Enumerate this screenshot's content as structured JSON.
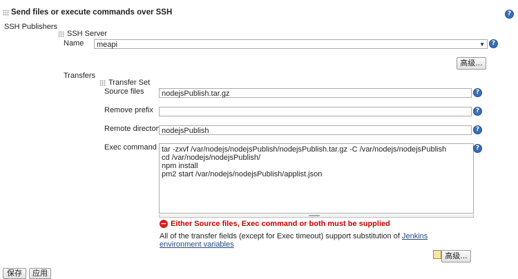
{
  "section": {
    "title": "Send files or execute commands over SSH"
  },
  "ssh_publishers_label": "SSH Publishers",
  "ssh_server": {
    "header": "SSH Server",
    "name_label": "Name",
    "name_value": "meapi",
    "advanced_button": "高级..."
  },
  "transfers": {
    "label": "Transfers",
    "set_header": "Transfer Set",
    "source_files_label": "Source files",
    "source_files_value": "nodejsPublish.tar.gz",
    "remove_prefix_label": "Remove prefix",
    "remove_prefix_value": "",
    "remote_directory_label": "Remote directory",
    "remote_directory_value": "nodejsPublish",
    "exec_command_label": "Exec command",
    "exec_command_value": "tar -zxvf /var/nodejs/nodejsPublish/nodejsPublish.tar.gz -C /var/nodejs/nodejsPublish\ncd /var/nodejs/nodejsPublish/\nnpm install\npm2 start /var/nodejs/nodejsPublish/applist.json",
    "error_message": "Either Source files, Exec command or both must be supplied",
    "info_text": "All of the transfer fields (except for Exec timeout) support substitution of ",
    "info_link": "Jenkins environment variables",
    "advanced_button": "高级..."
  },
  "bottom_buttons": {
    "save": "保存",
    "apply": "应用"
  },
  "help_symbol": "?",
  "error_symbol": "−",
  "dropdown_arrow": "▼",
  "colors": {
    "error": "#cc0000",
    "link": "#204a87",
    "help": "#3a6fb5"
  }
}
